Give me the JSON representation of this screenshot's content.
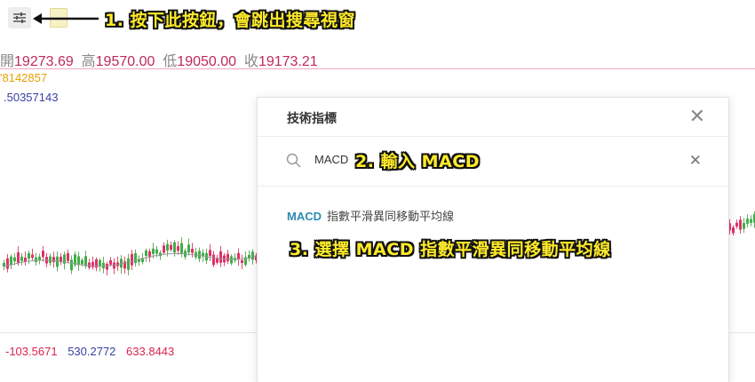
{
  "ohlc": {
    "open_label": "開",
    "open_value": "19273.69",
    "high_label": "高",
    "high_value": "19570.00",
    "low_label": "低",
    "low_value": "19050.00",
    "close_label": "收",
    "close_value": "19173.21"
  },
  "indicator_values": {
    "ma1": "'8142857",
    "ma2": ".50357143"
  },
  "macd_values": [
    {
      "value": "-103.5671",
      "color": "#d9234d"
    },
    {
      "value": "530.2772",
      "color": "#3a3fa0"
    },
    {
      "value": "633.8443",
      "color": "#d9234d"
    }
  ],
  "annotations": {
    "step1": "1. 按下此按鈕，會跳出搜尋視窗",
    "step2": "2. 輸入 MACD",
    "step3": "3. 選擇 MACD 指數平滑異同移動平均線"
  },
  "dialog": {
    "title": "技術指標",
    "search_value": "MACD",
    "result_code": "MACD",
    "result_name": "指數平滑異同移動平均線"
  },
  "icons": {
    "toolbar": "sliders-icon",
    "search": "search-icon",
    "close": "close-icon",
    "clear": "clear-icon"
  }
}
